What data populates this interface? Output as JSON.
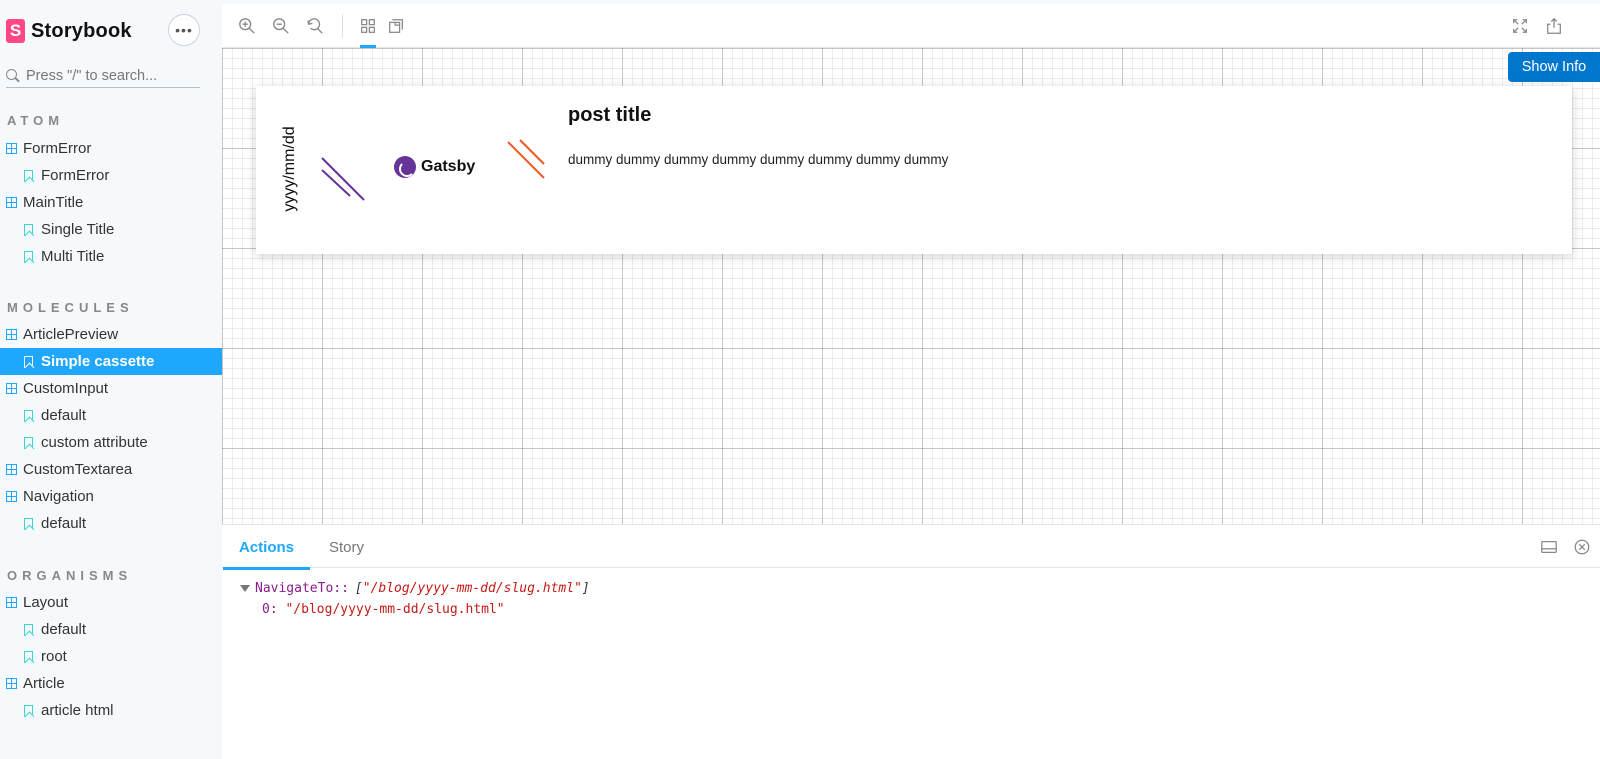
{
  "brand": {
    "name": "Storybook",
    "logo_letter": "S",
    "accent": "#ff4785"
  },
  "sidebar": {
    "menu_label": "•••",
    "search_placeholder": "Press \"/\" to search...",
    "sections": {
      "atom": "ATOM",
      "molecules": "MOLECULES",
      "organisms": "ORGANISMS"
    },
    "items": [
      {
        "label": "FormError",
        "kind": "component"
      },
      {
        "label": "FormError",
        "kind": "story"
      },
      {
        "label": "MainTitle",
        "kind": "component"
      },
      {
        "label": "Single Title",
        "kind": "story"
      },
      {
        "label": "Multi Title",
        "kind": "story"
      },
      {
        "label": "ArticlePreview",
        "kind": "component"
      },
      {
        "label": "Simple cassette",
        "kind": "story",
        "active": true
      },
      {
        "label": "CustomInput",
        "kind": "component"
      },
      {
        "label": "default",
        "kind": "story"
      },
      {
        "label": "custom attribute",
        "kind": "story"
      },
      {
        "label": "CustomTextarea",
        "kind": "component"
      },
      {
        "label": "Navigation",
        "kind": "component"
      },
      {
        "label": "default",
        "kind": "story"
      },
      {
        "label": "Layout",
        "kind": "component"
      },
      {
        "label": "default",
        "kind": "story"
      },
      {
        "label": "root",
        "kind": "story"
      },
      {
        "label": "Article",
        "kind": "component"
      },
      {
        "label": "article html",
        "kind": "story"
      }
    ],
    "active_color": "#1ea7fd"
  },
  "toolbar": {
    "icons": [
      "zoom-in-icon",
      "zoom-out-icon",
      "zoom-reset-icon",
      "grid-icon",
      "outline-icon",
      "fullscreen-icon",
      "share-icon"
    ]
  },
  "preview": {
    "show_info_label": "Show Info",
    "card": {
      "date": "yyyy/mm/dd",
      "brand": "Gatsby",
      "title": "post title",
      "excerpt": "dummy dummy dummy dummy dummy dummy dummy dummy"
    },
    "colors": {
      "purple": "#663399",
      "orange": "#f05a28"
    }
  },
  "panel": {
    "tabs": [
      "Actions",
      "Story"
    ],
    "active_tab": "Actions",
    "log": {
      "name": "NavigateTo:",
      "separator": ":",
      "bracket_open": "[",
      "summary": "\"/blog/yyyy-mm-dd/slug.html\"",
      "bracket_close": "]",
      "entry_key": "0:",
      "entry_value": "\"/blog/yyyy-mm-dd/slug.html\""
    }
  }
}
